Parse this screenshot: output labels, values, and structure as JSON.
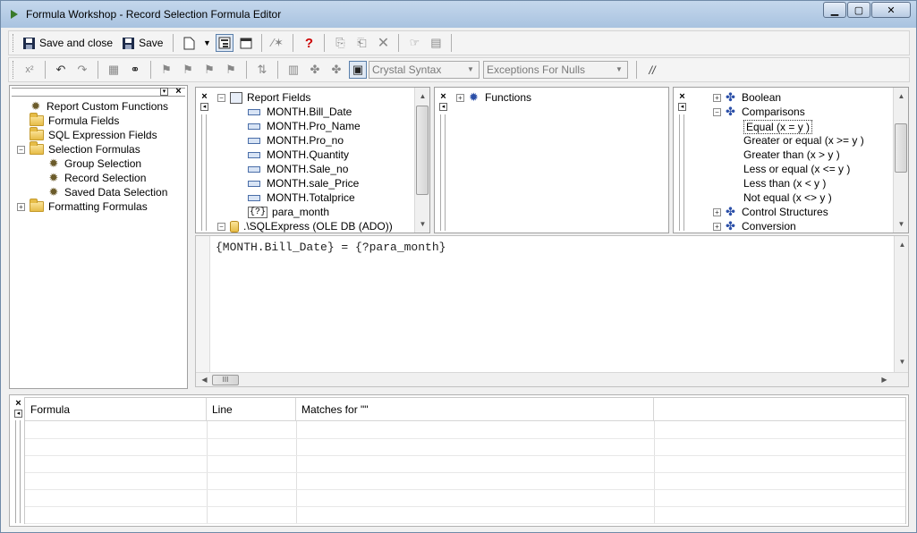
{
  "window": {
    "title": "Formula Workshop - Record Selection Formula Editor"
  },
  "toolbar1": {
    "save_close_label": "Save and close",
    "save_label": "Save"
  },
  "toolbar2": {
    "syntax_selected": "Crystal Syntax",
    "nulls_selected": "Exceptions For Nulls",
    "comment_label": "//"
  },
  "workshop_tree": {
    "items": [
      {
        "label": "Report Custom Functions",
        "icon": "gear-icon"
      },
      {
        "label": "Formula Fields",
        "icon": "folder-icon"
      },
      {
        "label": "SQL Expression Fields",
        "icon": "folder-icon"
      },
      {
        "label": "Selection Formulas",
        "icon": "folder-icon",
        "expander": "−"
      },
      {
        "label": "Group Selection",
        "icon": "formula-icon"
      },
      {
        "label": "Record Selection",
        "icon": "formula-icon"
      },
      {
        "label": "Saved Data Selection",
        "icon": "formula-icon"
      },
      {
        "label": "Formatting Formulas",
        "icon": "folder-icon",
        "expander": "+"
      }
    ]
  },
  "fields_tree": {
    "root": "Report Fields",
    "items": [
      "MONTH.Bill_Date",
      "MONTH.Pro_Name",
      "MONTH.Pro_no",
      "MONTH.Quantity",
      "MONTH.Sale_no",
      "MONTH.sale_Price",
      "MONTH.Totalprice"
    ],
    "param": "para_month",
    "param_icon": "{?}",
    "datasource": ".\\SQLExpress (OLE DB (ADO))"
  },
  "functions_tree": {
    "root": "Functions"
  },
  "operators_tree": {
    "items": [
      {
        "label": "Boolean",
        "level": 0,
        "expander": "+"
      },
      {
        "label": "Comparisons",
        "level": 0,
        "expander": "−"
      },
      {
        "label": "Equal (x = y )",
        "level": 1,
        "selected": true
      },
      {
        "label": "Greater or equal (x >= y )",
        "level": 1
      },
      {
        "label": "Greater than (x > y )",
        "level": 1
      },
      {
        "label": "Less or equal (x <= y )",
        "level": 1
      },
      {
        "label": "Less than (x < y )",
        "level": 1
      },
      {
        "label": "Not equal (x <> y )",
        "level": 1
      },
      {
        "label": "Control Structures",
        "level": 0,
        "expander": "+"
      },
      {
        "label": "Conversion",
        "level": 0,
        "expander": "+"
      }
    ]
  },
  "editor": {
    "formula_text": "{MONTH.Bill_Date} = {?para_month}",
    "hscroll_thumb": "III"
  },
  "results_grid": {
    "columns": [
      "Formula",
      "Line",
      "Matches for \"\""
    ]
  }
}
